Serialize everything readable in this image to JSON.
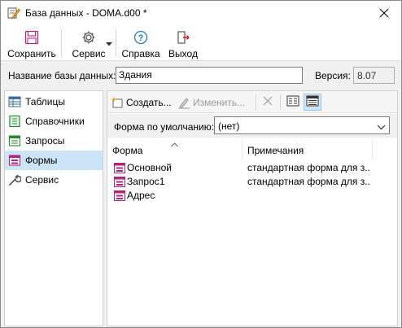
{
  "window": {
    "title": "База данных - DOMA.d00 *"
  },
  "toolbar": {
    "save_label": "Сохранить",
    "service_label": "Сервис",
    "help_label": "Справка",
    "exit_label": "Выход"
  },
  "db": {
    "name_label": "Название базы данных:",
    "name_value": "Здания",
    "version_label": "Версия:",
    "version_value": "8.07"
  },
  "nav": {
    "items": [
      {
        "label": "Таблицы"
      },
      {
        "label": "Справочники"
      },
      {
        "label": "Запросы"
      },
      {
        "label": "Формы"
      },
      {
        "label": "Сервис"
      }
    ],
    "selected": "Формы"
  },
  "panel": {
    "create_label": "Создать...",
    "edit_label": "Изменить...",
    "default_form_label": "Форма по умолчанию:",
    "default_form_value": "(нет)",
    "columns": [
      "Форма",
      "Примечания"
    ],
    "rows": [
      {
        "name": "Основной",
        "note": "стандартная форма для з..."
      },
      {
        "name": "Запрос1",
        "note": "стандартная форма для з..."
      },
      {
        "name": "Адрес",
        "note": ""
      }
    ]
  },
  "colors": {
    "selection": "#cce4f7",
    "accent_blue": "#1e78d4"
  }
}
